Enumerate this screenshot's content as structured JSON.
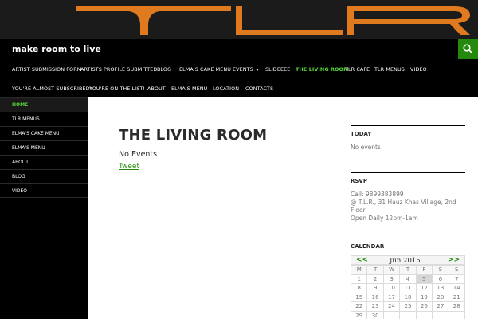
{
  "site": {
    "title": "make room to live",
    "logo_text": "TLR"
  },
  "colors": {
    "accent": "#24890d",
    "active_link": "#55d737",
    "logo": "#e07a1f",
    "header_bg": "#1b1b1b"
  },
  "icons": {
    "search": "search-icon",
    "caret": "chevron-down-icon"
  },
  "primary_nav": {
    "items": [
      {
        "label": "ARTIST SUBMISSION FORM"
      },
      {
        "label": "ARTISTS PROFILE SUBMITTED"
      },
      {
        "label": "BLOG"
      },
      {
        "label": "ELMA'S CAKE MENU"
      },
      {
        "label": "EVENTS"
      },
      {
        "label": "SLIDEEEE"
      },
      {
        "label": "THE LIVING ROOM"
      },
      {
        "label": "TLR CAFE"
      },
      {
        "label": "TLR MENUS"
      },
      {
        "label": "VIDEO"
      },
      {
        "label": "YOU'RE ALMOST SUBSCRIBED!"
      },
      {
        "label": "YOU'RE ON THE LIST!"
      },
      {
        "label": "ABOUT"
      },
      {
        "label": "ELMA'S MENU"
      },
      {
        "label": "LOCATION"
      },
      {
        "label": "CONTACTS"
      }
    ]
  },
  "left_nav": {
    "items": [
      {
        "label": "HOME"
      },
      {
        "label": "TLR MENUS"
      },
      {
        "label": "ELMA'S CAKE MENU"
      },
      {
        "label": "ELMA'S MENU"
      },
      {
        "label": "ABOUT"
      },
      {
        "label": "BLOG"
      },
      {
        "label": "VIDEO"
      }
    ]
  },
  "main": {
    "title": "THE LIVING ROOM",
    "no_events": "No Events",
    "tweet": "Tweet"
  },
  "widgets": {
    "today": {
      "title": "TODAY",
      "body": "No events"
    },
    "rsvp": {
      "title": "RSVP",
      "line1": "Call: 9899383899",
      "line2": "@ T.L.R., 31 Hauz Khas Village, 2nd Floor",
      "line3": "Open Daily 12pm-1am"
    },
    "calendar": {
      "title": "CALENDAR",
      "prev": "<<",
      "next": ">>",
      "month": "Jun 2015",
      "weekdays": [
        "M",
        "T",
        "W",
        "T",
        "F",
        "S",
        "S"
      ],
      "today": "5",
      "weeks": [
        [
          "1",
          "2",
          "3",
          "4",
          "5",
          "6",
          "7"
        ],
        [
          "8",
          "9",
          "10",
          "11",
          "12",
          "13",
          "14"
        ],
        [
          "15",
          "16",
          "17",
          "18",
          "19",
          "20",
          "21"
        ],
        [
          "22",
          "23",
          "24",
          "25",
          "26",
          "27",
          "28"
        ],
        [
          "29",
          "30",
          "",
          "",
          "",
          "",
          ""
        ]
      ]
    }
  }
}
